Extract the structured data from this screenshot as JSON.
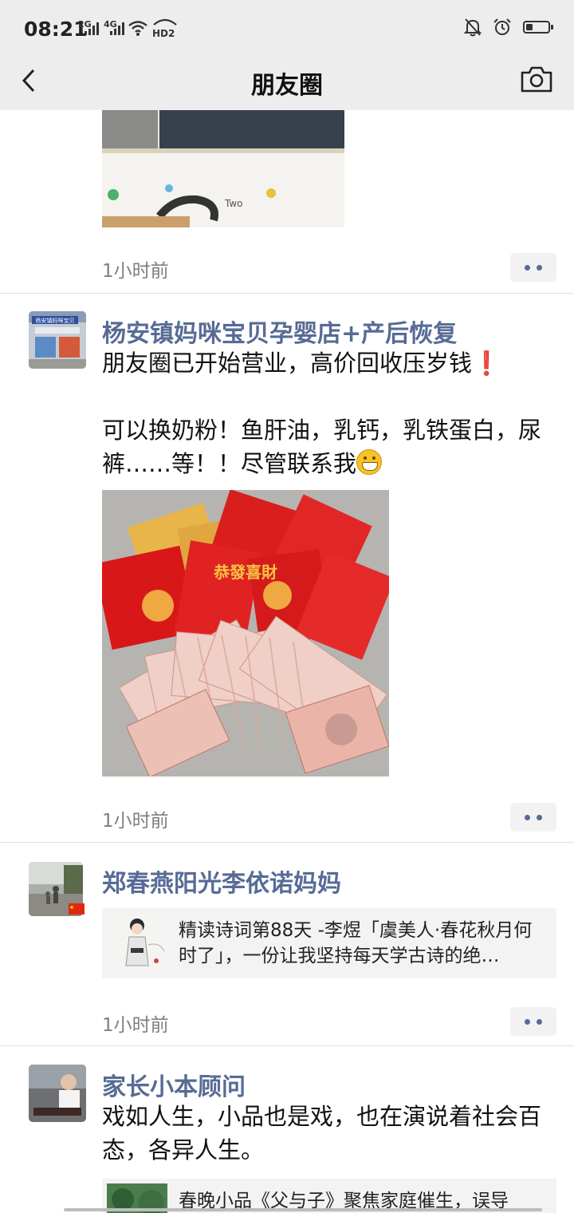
{
  "status_bar": {
    "time": "08:21",
    "net_1": "2G",
    "net_2": "4G",
    "hd": "HD2",
    "battery_level": 0.3
  },
  "nav": {
    "title": "朋友圈"
  },
  "posts": [
    {
      "time": "1小时前",
      "photo_text": "Two"
    },
    {
      "author": "杨安镇妈咪宝贝孕婴店+产后恢复",
      "text_line1": "朋友圈已开始营业，高价回收压岁钱",
      "exclaim": "❗",
      "text_line2": "可以换奶粉！鱼肝油，乳钙，乳铁蛋白，尿裤……等！！尽管联系我",
      "time": "1小时前",
      "avatar_sign": "杨安镇妈咪宝贝",
      "envelope_text": "恭發喜財"
    },
    {
      "author": "郑春燕阳光李依诺妈妈",
      "link_text": "精读诗词第88天 -李煜「虞美人·春花秋月何时了」，一份让我坚持每天学古诗的绝…",
      "time": "1小时前"
    },
    {
      "author": "家长小本顾问",
      "text": "戏如人生，小品也是戏，也在演说着社会百态，各异人生。",
      "link_text": "春晚小品《父与子》聚焦家庭催生，误导"
    }
  ]
}
